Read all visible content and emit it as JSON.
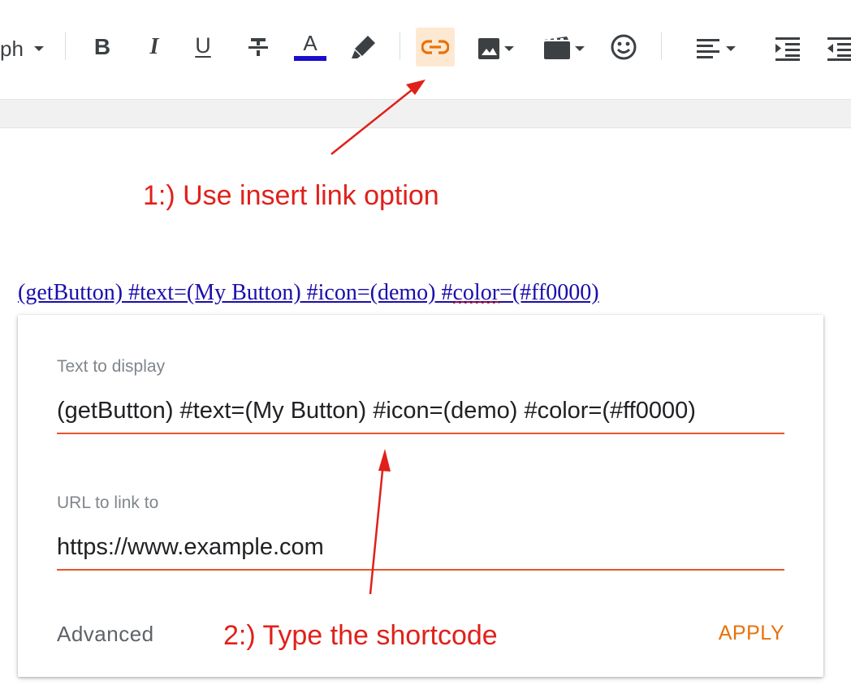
{
  "toolbar": {
    "paragraph_label": "ph",
    "active_bg": "#fde9d2",
    "active_color": "#e8710a",
    "font_color_underline": "#1a0dcc",
    "icons": [
      "chevron-down-icon",
      "bold-icon",
      "italic-icon",
      "underline-icon",
      "strikethrough-icon",
      "font-color-icon",
      "highlighter-icon",
      "link-icon",
      "image-icon",
      "video-icon",
      "emoji-icon",
      "align-icon",
      "indent-icon",
      "outdent-icon"
    ],
    "bold_glyph": "B",
    "italic_glyph": "I",
    "underline_glyph": "U",
    "font_color_glyph": "A"
  },
  "annotations": {
    "step1": "1:) Use insert link option",
    "step2": "2:) Type the shortcode",
    "color": "#e0201a"
  },
  "editor": {
    "link_part1": "(getButton) #text=(My Button) #icon=(demo) #",
    "link_misspelled": "color",
    "link_part2": "=(#ff0000)"
  },
  "link_dialog": {
    "text_label": "Text to display",
    "text_value": "(getButton) #text=(My Button) #icon=(demo) #color=(#ff0000)",
    "url_label": "URL to link to",
    "url_value": "https://www.example.com",
    "advanced_label": "Advanced",
    "apply_label": "APPLY"
  }
}
